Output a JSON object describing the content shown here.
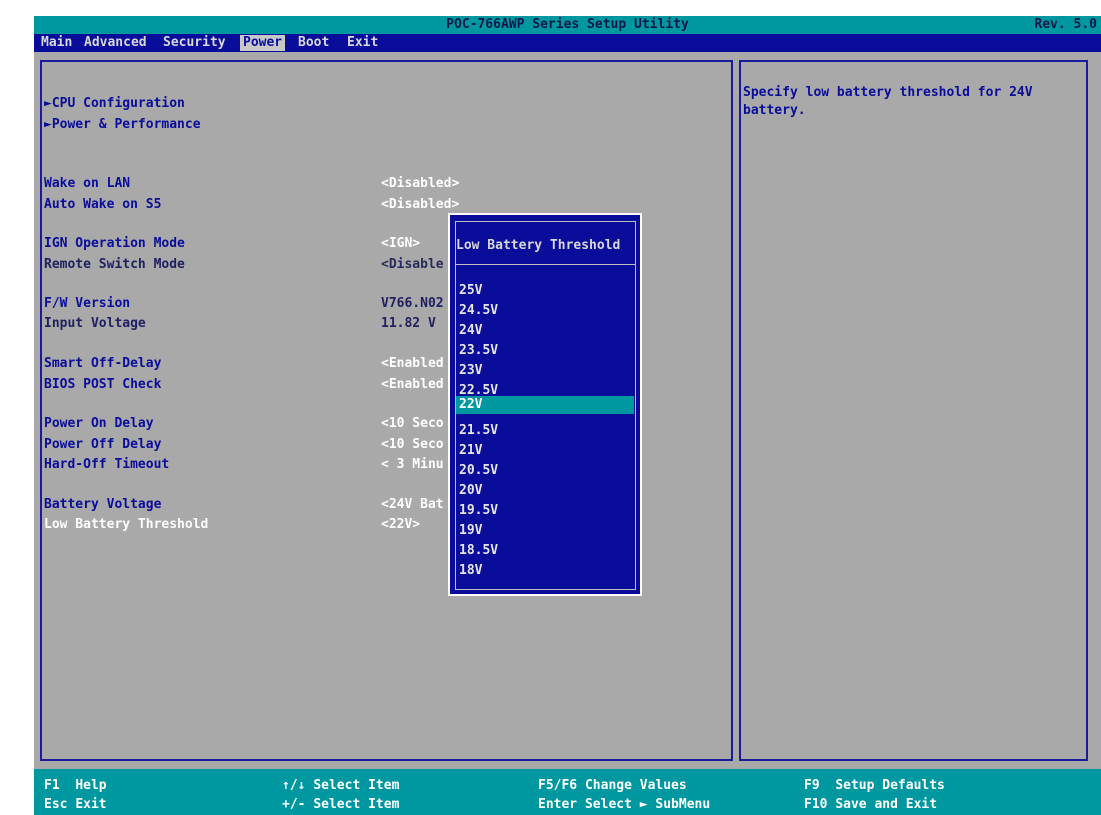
{
  "title_bar": {
    "title": "POC-766AWP Series Setup Utility",
    "revision": "Rev. 5.0"
  },
  "menu": {
    "items": [
      "Main",
      "Advanced",
      "Security",
      "Power",
      "Boot",
      "Exit"
    ],
    "active": "Power"
  },
  "submenus": [
    "►CPU Configuration",
    "►Power & Performance"
  ],
  "settings": [
    {
      "label": "Wake on LAN",
      "value": "<Disabled>"
    },
    {
      "label": "Auto Wake on S5",
      "value": "<Disabled>"
    },
    {
      "label": "IGN Operation Mode",
      "value": "<IGN>"
    },
    {
      "label": "Remote Switch Mode",
      "value": "<Disable"
    },
    {
      "label": "F/W Version",
      "value": "V766.N02"
    },
    {
      "label": "Input Voltage",
      "value": "11.82 V"
    },
    {
      "label": "Smart Off-Delay",
      "value": "<Enabled"
    },
    {
      "label": "BIOS POST Check",
      "value": "<Enabled"
    },
    {
      "label": "Power On Delay",
      "value": "<10 Seco"
    },
    {
      "label": "Power Off Delay",
      "value": "<10 Seco"
    },
    {
      "label": "Hard-Off Timeout",
      "value": "< 3 Minu"
    },
    {
      "label": "Battery Voltage",
      "value": "<24V Bat"
    },
    {
      "label": "Low Battery Threshold",
      "value": "<22V>"
    }
  ],
  "help": {
    "text": "Specify low battery threshold for 24V battery."
  },
  "popup": {
    "title": "Low Battery Threshold",
    "options": [
      "25V",
      "24.5V",
      "24V",
      "23.5V",
      "23V",
      "22.5V",
      "22V",
      "21.5V",
      "21V",
      "20.5V",
      "20V",
      "19.5V",
      "19V",
      "18.5V",
      "18V"
    ],
    "selected": "22V"
  },
  "footer": {
    "f1": {
      "key": "F1",
      "action": "Help"
    },
    "esc": {
      "key": "Esc",
      "action": "Exit"
    },
    "updown": {
      "key": "↑/↓",
      "action": "Select Item"
    },
    "plusminus": {
      "key": "+/-",
      "action": "Select Item"
    },
    "f5f6": {
      "key": "F5/F6",
      "action": "Change Values"
    },
    "enter": {
      "key": "Enter",
      "action": "Select ► SubMenu"
    },
    "f9": {
      "key": "F9",
      "action": "Setup Defaults"
    },
    "f10": {
      "key": "F10",
      "action": "Save and Exit"
    }
  },
  "colors": {
    "bios_blue": "#0a0c9a",
    "teal": "#0098a0",
    "panel_gray": "#a9a9a9"
  }
}
